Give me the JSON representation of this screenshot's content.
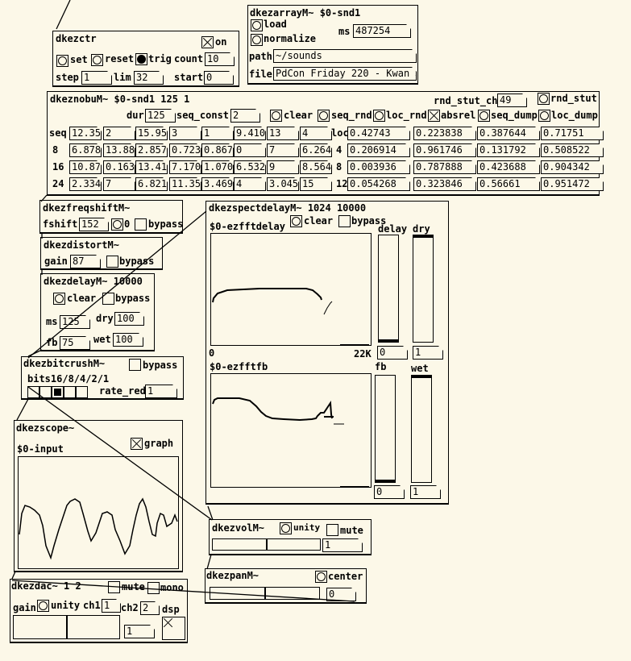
{
  "ctr": {
    "title": "dkezctr",
    "on": "on",
    "set": "set",
    "reset": "reset",
    "trig": "trig",
    "count_label": "count",
    "count": "10",
    "step_label": "step",
    "step": "1",
    "lim_label": "lim",
    "lim": "32",
    "start_label": "start",
    "start": "0"
  },
  "array": {
    "title": "dkezarrayM~ $0-snd1",
    "load": "load",
    "normalize": "normalize",
    "ms_label": "ms",
    "ms": "487254",
    "path_label": "path",
    "path": "~/sounds",
    "file_label": "file",
    "file": "PdCon Friday 220 - Kwan >"
  },
  "nobu": {
    "title": "dkeznobuM~ $0-snd1 125 1",
    "rnd_stut_ch_label": "rnd_stut_ch",
    "rnd_stut_ch": "49",
    "rnd_stut": "rnd_stut",
    "dur_label": "dur",
    "dur": "125",
    "seq_const_label": "seq_const",
    "seq_const": "2",
    "clear": "clear",
    "seq_rnd": "seq_rnd",
    "loc_rnd": "loc_rnd",
    "absrel": "absrel",
    "seq_dump": "seq_dump",
    "loc_dump": "loc_dump",
    "seq_label": "seq",
    "loc_label": "loc",
    "seq_rows": [
      {
        "label": "",
        "values": [
          "12.35",
          "2",
          "15.95",
          "3",
          "1",
          "9.410",
          "13",
          "4"
        ]
      },
      {
        "label": "8",
        "values": [
          "6.878",
          "13.88",
          "2.857",
          "0.723",
          "0.867",
          "0",
          "7",
          "6.264"
        ]
      },
      {
        "label": "16",
        "values": [
          "10.87",
          "0.163",
          "13.41",
          "7.170",
          "1.070",
          "6.532",
          "9",
          "8.564"
        ]
      },
      {
        "label": "24",
        "values": [
          "2.334",
          "7",
          "6.821",
          "11.35",
          "3.469",
          "4",
          "3.045",
          "15"
        ]
      }
    ],
    "loc_rows": [
      {
        "label": "",
        "values": [
          "0.42743",
          "0.223838",
          "0.387644",
          "0.71751"
        ]
      },
      {
        "label": "4",
        "values": [
          "0.206914",
          "0.961746",
          "0.131792",
          "0.508522"
        ]
      },
      {
        "label": "8",
        "values": [
          "0.003936",
          "0.787888",
          "0.423688",
          "0.904342"
        ]
      },
      {
        "label": "12",
        "values": [
          "0.054268",
          "0.323846",
          "0.56661",
          "0.951472"
        ]
      }
    ]
  },
  "freqshift": {
    "title": "dkezfreqshiftM~",
    "fshift_label": "fshift",
    "fshift": "152",
    "zero": "0",
    "bypass": "bypass"
  },
  "distort": {
    "title": "dkezdistortM~",
    "gain_label": "gain",
    "gain": "87",
    "bypass": "bypass"
  },
  "delay": {
    "title": "dkezdelayM~ 10000",
    "clear": "clear",
    "bypass": "bypass",
    "ms_label": "ms",
    "ms": "125",
    "dry_label": "dry",
    "dry": "100",
    "fb_label": "fb",
    "fb": "75",
    "wet_label": "wet",
    "wet": "100"
  },
  "spect": {
    "title": "dkezspectdelayM~ 1024 10000",
    "array1": "$0-ezfftdelay",
    "clear": "clear",
    "bypass": "bypass",
    "delay_label": "delay",
    "dry_label": "dry",
    "axis_min": "0",
    "axis_max": "22K",
    "delay_val": "0",
    "dry_val": "1",
    "array2": "$0-ezfftfb",
    "fb_label": "fb",
    "wet_label": "wet",
    "fb_val": "0",
    "wet_val": "1"
  },
  "bitcrush": {
    "title": "dkezbitcrushM~",
    "bypass": "bypass",
    "bits_label": "bits16/8/4/2/1",
    "rate_label": "rate_red",
    "rate": "1",
    "selected_bit_index": 2
  },
  "scope": {
    "title": "dkezscope~",
    "array": "$0-input",
    "graph": "graph"
  },
  "vol": {
    "title": "dkezvolM~",
    "unity": "unity",
    "mute": "mute",
    "value": "1",
    "level": 0.5
  },
  "pan": {
    "title": "dkezpanM~",
    "center": "center",
    "value": "0",
    "level": 0.5
  },
  "dac": {
    "title": "dkezdac~ 1 2",
    "mute": "mute",
    "mono": "mono",
    "gain_label": "gain",
    "unity": "unity",
    "ch1_label": "ch1",
    "ch1": "1",
    "ch2_label": "ch2",
    "ch2": "2",
    "dsp_label": "dsp",
    "gain_val": "1",
    "level": 0.5
  }
}
